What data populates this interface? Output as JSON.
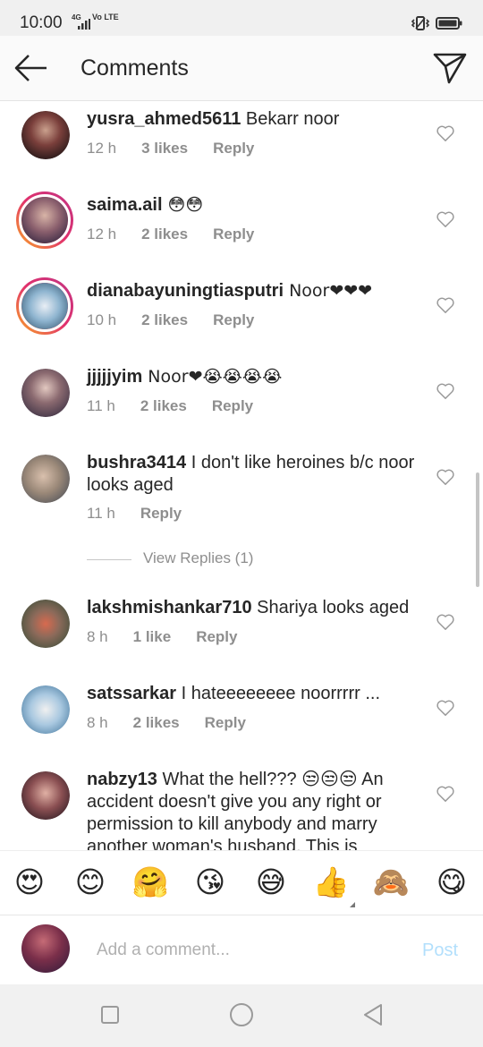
{
  "status_bar": {
    "time": "10:00",
    "network": "4G",
    "volte": "Vo LTE",
    "icons": [
      "signal-icon",
      "vibrate-icon",
      "battery-icon"
    ]
  },
  "header": {
    "title": "Comments",
    "back_icon": "back-arrow-icon",
    "direct_icon": "paper-plane-icon"
  },
  "comments": [
    {
      "username": "yusra_ahmed5611",
      "text": " Bekarr noor",
      "time": "12 h",
      "likes": "3 likes",
      "reply": "Reply"
    },
    {
      "username": "saima.ail",
      "text": " 😳😳",
      "time": "12 h",
      "likes": "2 likes",
      "reply": "Reply"
    },
    {
      "username": "dianabayuningtiasputri",
      "text": " Noor❤❤❤",
      "time": "10 h",
      "likes": "2 likes",
      "reply": "Reply"
    },
    {
      "username": "jjjjjyim",
      "text": " Noor❤😭😭😭😭",
      "time": "11 h",
      "likes": "2 likes",
      "reply": "Reply"
    },
    {
      "username": "bushra3414",
      "text": " I don't like heroines b/c noor looks aged",
      "time": "11 h",
      "likes": "",
      "reply": "Reply",
      "view_replies": "View Replies (1)"
    },
    {
      "username": "lakshmishankar710",
      "text": " Shariya looks aged",
      "time": "8 h",
      "likes": "1 like",
      "reply": "Reply"
    },
    {
      "username": "satssarkar",
      "text": " I hateeeeeeee noorrrrr ...",
      "time": "8 h",
      "likes": "2 likes",
      "reply": "Reply"
    },
    {
      "username": "nabzy13",
      "text": " What the hell??? 😒😒😒 An accident doesn't give you any right or permission to kill anybody and marry another woman's husband. This is",
      "time": "",
      "likes": "",
      "reply": ""
    }
  ],
  "emoji_bar": [
    "😍",
    "😊",
    "🤗",
    "😘",
    "😅",
    "👍",
    "🙈",
    "😋"
  ],
  "composer": {
    "placeholder": "Add a comment...",
    "post_label": "Post"
  },
  "colors": {
    "post_disabled": "#b2dffc",
    "meta_gray": "#8e8e8e",
    "text": "#262626",
    "story_ring": "#e1306c"
  }
}
